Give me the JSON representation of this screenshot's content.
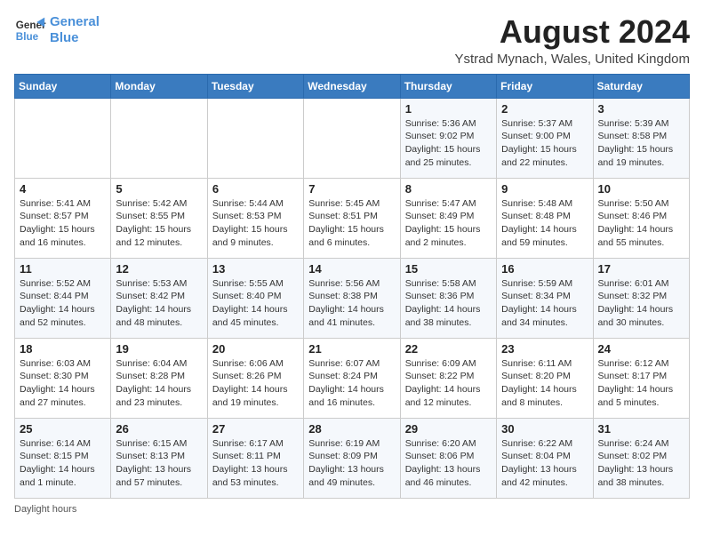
{
  "logo": {
    "line1": "General",
    "line2": "Blue"
  },
  "title": "August 2024",
  "subtitle": "Ystrad Mynach, Wales, United Kingdom",
  "columns": [
    "Sunday",
    "Monday",
    "Tuesday",
    "Wednesday",
    "Thursday",
    "Friday",
    "Saturday"
  ],
  "weeks": [
    [
      {
        "day": "",
        "info": ""
      },
      {
        "day": "",
        "info": ""
      },
      {
        "day": "",
        "info": ""
      },
      {
        "day": "",
        "info": ""
      },
      {
        "day": "1",
        "info": "Sunrise: 5:36 AM\nSunset: 9:02 PM\nDaylight: 15 hours\nand 25 minutes."
      },
      {
        "day": "2",
        "info": "Sunrise: 5:37 AM\nSunset: 9:00 PM\nDaylight: 15 hours\nand 22 minutes."
      },
      {
        "day": "3",
        "info": "Sunrise: 5:39 AM\nSunset: 8:58 PM\nDaylight: 15 hours\nand 19 minutes."
      }
    ],
    [
      {
        "day": "4",
        "info": "Sunrise: 5:41 AM\nSunset: 8:57 PM\nDaylight: 15 hours\nand 16 minutes."
      },
      {
        "day": "5",
        "info": "Sunrise: 5:42 AM\nSunset: 8:55 PM\nDaylight: 15 hours\nand 12 minutes."
      },
      {
        "day": "6",
        "info": "Sunrise: 5:44 AM\nSunset: 8:53 PM\nDaylight: 15 hours\nand 9 minutes."
      },
      {
        "day": "7",
        "info": "Sunrise: 5:45 AM\nSunset: 8:51 PM\nDaylight: 15 hours\nand 6 minutes."
      },
      {
        "day": "8",
        "info": "Sunrise: 5:47 AM\nSunset: 8:49 PM\nDaylight: 15 hours\nand 2 minutes."
      },
      {
        "day": "9",
        "info": "Sunrise: 5:48 AM\nSunset: 8:48 PM\nDaylight: 14 hours\nand 59 minutes."
      },
      {
        "day": "10",
        "info": "Sunrise: 5:50 AM\nSunset: 8:46 PM\nDaylight: 14 hours\nand 55 minutes."
      }
    ],
    [
      {
        "day": "11",
        "info": "Sunrise: 5:52 AM\nSunset: 8:44 PM\nDaylight: 14 hours\nand 52 minutes."
      },
      {
        "day": "12",
        "info": "Sunrise: 5:53 AM\nSunset: 8:42 PM\nDaylight: 14 hours\nand 48 minutes."
      },
      {
        "day": "13",
        "info": "Sunrise: 5:55 AM\nSunset: 8:40 PM\nDaylight: 14 hours\nand 45 minutes."
      },
      {
        "day": "14",
        "info": "Sunrise: 5:56 AM\nSunset: 8:38 PM\nDaylight: 14 hours\nand 41 minutes."
      },
      {
        "day": "15",
        "info": "Sunrise: 5:58 AM\nSunset: 8:36 PM\nDaylight: 14 hours\nand 38 minutes."
      },
      {
        "day": "16",
        "info": "Sunrise: 5:59 AM\nSunset: 8:34 PM\nDaylight: 14 hours\nand 34 minutes."
      },
      {
        "day": "17",
        "info": "Sunrise: 6:01 AM\nSunset: 8:32 PM\nDaylight: 14 hours\nand 30 minutes."
      }
    ],
    [
      {
        "day": "18",
        "info": "Sunrise: 6:03 AM\nSunset: 8:30 PM\nDaylight: 14 hours\nand 27 minutes."
      },
      {
        "day": "19",
        "info": "Sunrise: 6:04 AM\nSunset: 8:28 PM\nDaylight: 14 hours\nand 23 minutes."
      },
      {
        "day": "20",
        "info": "Sunrise: 6:06 AM\nSunset: 8:26 PM\nDaylight: 14 hours\nand 19 minutes."
      },
      {
        "day": "21",
        "info": "Sunrise: 6:07 AM\nSunset: 8:24 PM\nDaylight: 14 hours\nand 16 minutes."
      },
      {
        "day": "22",
        "info": "Sunrise: 6:09 AM\nSunset: 8:22 PM\nDaylight: 14 hours\nand 12 minutes."
      },
      {
        "day": "23",
        "info": "Sunrise: 6:11 AM\nSunset: 8:20 PM\nDaylight: 14 hours\nand 8 minutes."
      },
      {
        "day": "24",
        "info": "Sunrise: 6:12 AM\nSunset: 8:17 PM\nDaylight: 14 hours\nand 5 minutes."
      }
    ],
    [
      {
        "day": "25",
        "info": "Sunrise: 6:14 AM\nSunset: 8:15 PM\nDaylight: 14 hours\nand 1 minute."
      },
      {
        "day": "26",
        "info": "Sunrise: 6:15 AM\nSunset: 8:13 PM\nDaylight: 13 hours\nand 57 minutes."
      },
      {
        "day": "27",
        "info": "Sunrise: 6:17 AM\nSunset: 8:11 PM\nDaylight: 13 hours\nand 53 minutes."
      },
      {
        "day": "28",
        "info": "Sunrise: 6:19 AM\nSunset: 8:09 PM\nDaylight: 13 hours\nand 49 minutes."
      },
      {
        "day": "29",
        "info": "Sunrise: 6:20 AM\nSunset: 8:06 PM\nDaylight: 13 hours\nand 46 minutes."
      },
      {
        "day": "30",
        "info": "Sunrise: 6:22 AM\nSunset: 8:04 PM\nDaylight: 13 hours\nand 42 minutes."
      },
      {
        "day": "31",
        "info": "Sunrise: 6:24 AM\nSunset: 8:02 PM\nDaylight: 13 hours\nand 38 minutes."
      }
    ]
  ],
  "footer": "Daylight hours"
}
